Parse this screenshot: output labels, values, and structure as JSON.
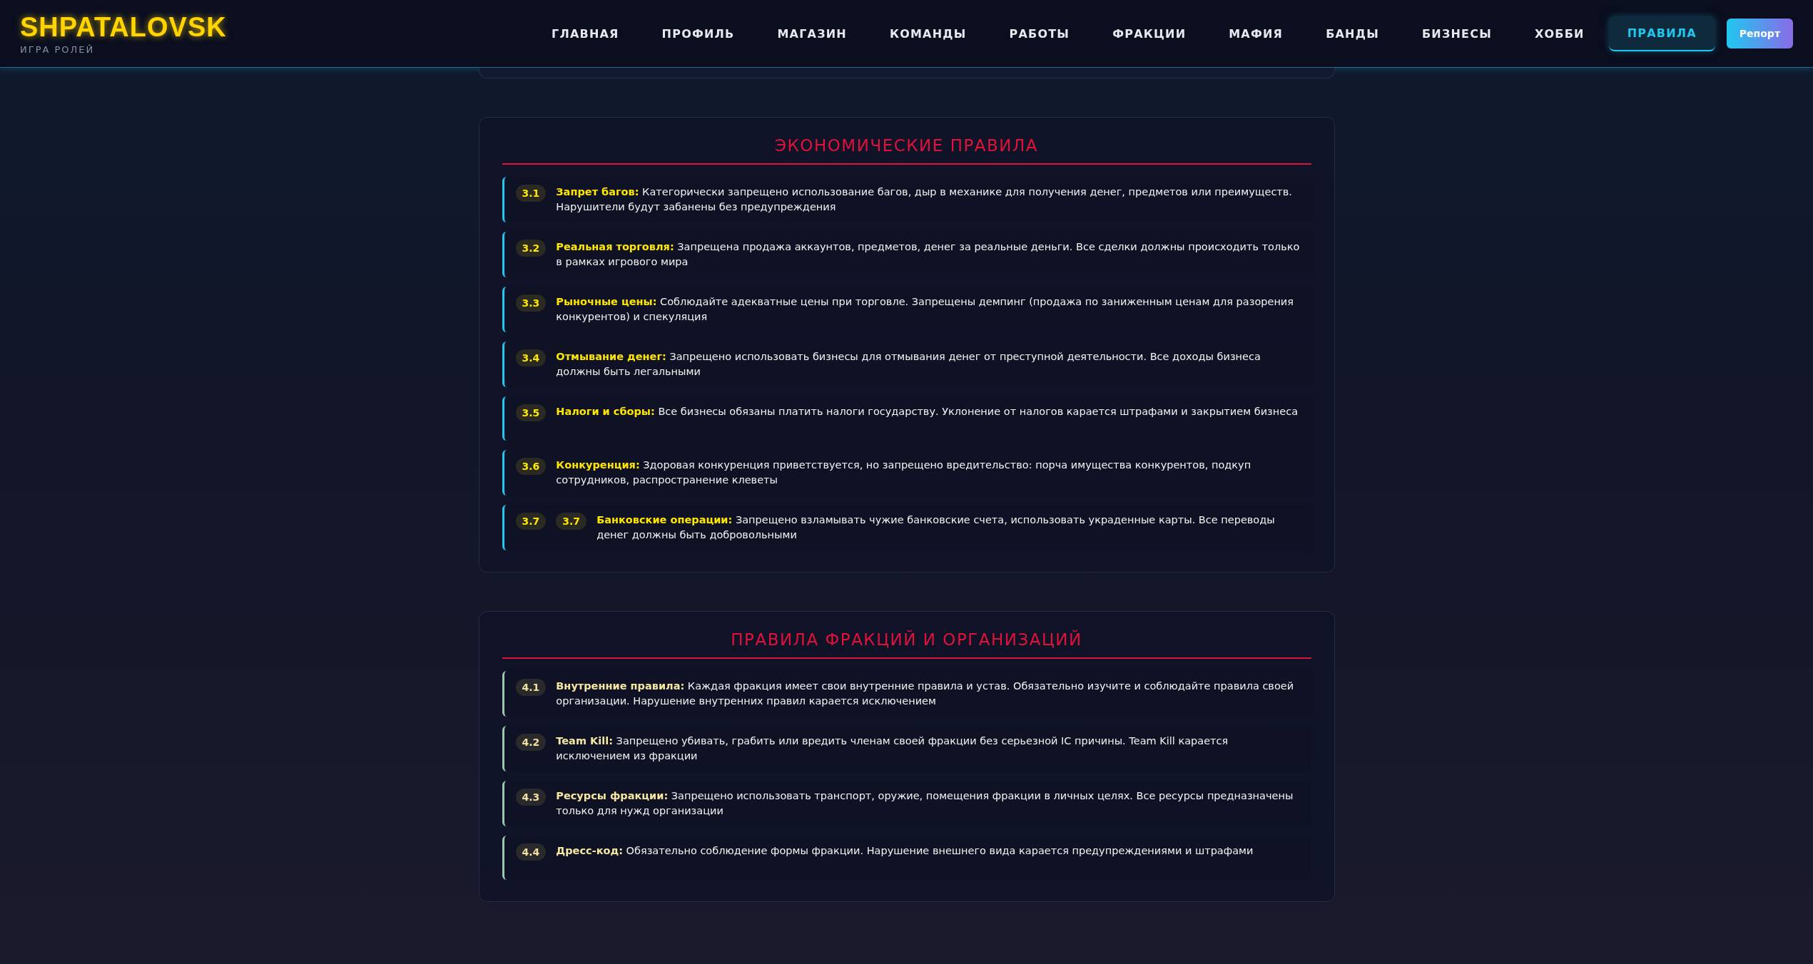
{
  "brand": {
    "title": "SHPATALOVSK",
    "subtitle": "ИГРА РОЛЕЙ"
  },
  "nav": [
    {
      "label": "ГЛАВНАЯ",
      "selected": false
    },
    {
      "label": "ПРОФИЛЬ",
      "selected": false
    },
    {
      "label": "МАГАЗИН",
      "selected": false
    },
    {
      "label": "КОМАНДЫ",
      "selected": false
    },
    {
      "label": "РАБОТЫ",
      "selected": false
    },
    {
      "label": "ФРАКЦИИ",
      "selected": false
    },
    {
      "label": "МАФИЯ",
      "selected": false
    },
    {
      "label": "БАНДЫ",
      "selected": false
    },
    {
      "label": "БИЗНЕСЫ",
      "selected": false
    },
    {
      "label": "ХОББИ",
      "selected": false
    },
    {
      "label": "ПРАВИЛА",
      "selected": true
    }
  ],
  "report_button": "Репорт",
  "sections": [
    {
      "title": "ЭКОНОМИЧЕСКИЕ ПРАВИЛА",
      "dimmed": false,
      "rules": [
        {
          "numbers": [
            "3.1"
          ],
          "name": "Запрет багов:",
          "text": "Категорически запрещено использование багов, дыр в механике для получения денег, предметов или преимуществ. Нарушители будут забанены без предупреждения"
        },
        {
          "numbers": [
            "3.2"
          ],
          "name": "Реальная торговля:",
          "text": "Запрещена продажа аккаунтов, предметов, денег за реальные деньги. Все сделки должны происходить только в рамках игрового мира"
        },
        {
          "numbers": [
            "3.3"
          ],
          "name": "Рыночные цены:",
          "text": "Соблюдайте адекватные цены при торговле. Запрещены демпинг (продажа по заниженным ценам для разорения конкурентов) и спекуляция"
        },
        {
          "numbers": [
            "3.4"
          ],
          "name": "Отмывание денег:",
          "text": "Запрещено использовать бизнесы для отмывания денег от преступной деятельности. Все доходы бизнеса должны быть легальными"
        },
        {
          "numbers": [
            "3.5"
          ],
          "name": "Налоги и сборы:",
          "text": "Все бизнесы обязаны платить налоги государству. Уклонение от налогов карается штрафами и закрытием бизнеса"
        },
        {
          "numbers": [
            "3.6"
          ],
          "name": "Конкуренция:",
          "text": "Здоровая конкуренция приветствуется, но запрещено вредительство: порча имущества конкурентов, подкуп сотрудников, распространение клеветы"
        },
        {
          "numbers": [
            "3.7",
            "3.7"
          ],
          "name": "Банковские операции:",
          "text": "Запрещено взламывать чужие банковские счета, использовать украденные карты. Все переводы денег должны быть добровольными"
        }
      ]
    },
    {
      "title": "ПРАВИЛА ФРАКЦИЙ И ОРГАНИЗАЦИЙ",
      "dimmed": true,
      "rules": [
        {
          "numbers": [
            "4.1"
          ],
          "name": "Внутренние правила:",
          "text": "Каждая фракция имеет свои внутренние правила и устав. Обязательно изучите и соблюдайте правила своей организации. Нарушение внутренних правил карается исключением"
        },
        {
          "numbers": [
            "4.2"
          ],
          "name": "Team Kill:",
          "text": "Запрещено убивать, грабить или вредить членам своей фракции без серьезной IC причины. Team Kill карается исключением из фракции"
        },
        {
          "numbers": [
            "4.3"
          ],
          "name": "Ресурсы фракции:",
          "text": "Запрещено использовать транспорт, оружие, помещения фракции в личных целях. Все ресурсы предназначены только для нужд организации"
        },
        {
          "numbers": [
            "4.4"
          ],
          "name": "Дресс-код:",
          "text": "Обязательно соблюдение формы фракции. Нарушение внешнего вида карается предупреждениями и штрафами"
        }
      ]
    }
  ]
}
